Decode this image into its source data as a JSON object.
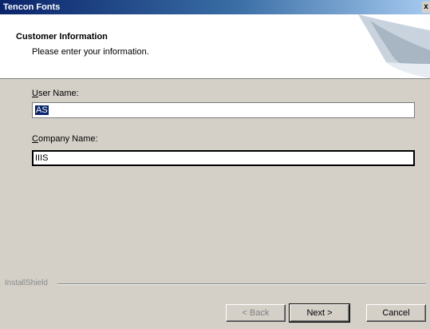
{
  "window": {
    "title": "Tencon Fonts",
    "close_glyph": "x"
  },
  "banner": {
    "heading": "Customer Information",
    "subtitle": "Please enter your information.",
    "art_icon": "page-curl-icon"
  },
  "form": {
    "user_name": {
      "label_prefix": "",
      "label_hotkey": "U",
      "label_suffix": "ser Name:",
      "value": "AS"
    },
    "company_name": {
      "label_prefix": "",
      "label_hotkey": "C",
      "label_suffix": "ompany Name:",
      "value": "IIIS"
    }
  },
  "footer": {
    "brand": "InstallShield",
    "back_label": "< Back",
    "next_label": "Next >",
    "cancel_label": "Cancel"
  }
}
